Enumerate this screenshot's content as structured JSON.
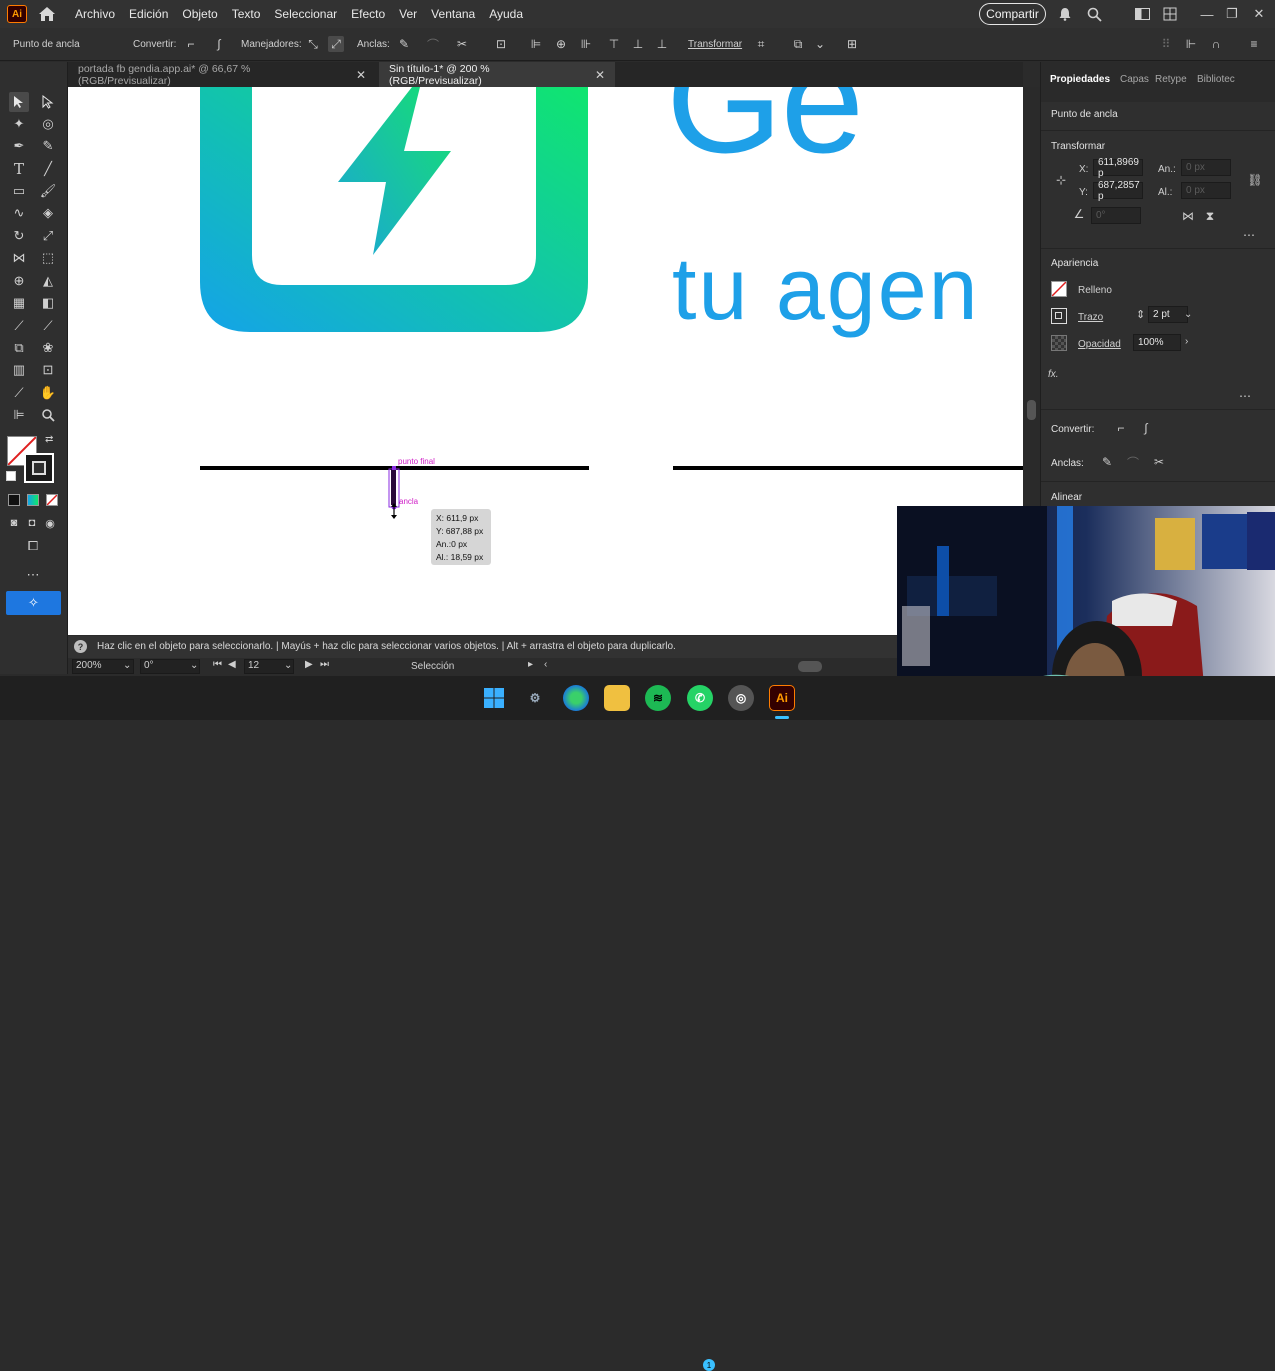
{
  "app": {
    "logo_text": "Ai"
  },
  "menu": {
    "items": [
      "Archivo",
      "Edición",
      "Objeto",
      "Texto",
      "Seleccionar",
      "Efecto",
      "Ver",
      "Ventana",
      "Ayuda"
    ],
    "share_label": "Compartir"
  },
  "control_bar": {
    "tool_name": "Punto de ancla",
    "convertir_label": "Convertir:",
    "manejadores_label": "Manejadores:",
    "anclas_label": "Anclas:",
    "transformar_label": "Transformar"
  },
  "tabs": [
    {
      "label": "portada fb gendia.app.ai* @ 66,67 % (RGB/Previsualizar)",
      "active": false
    },
    {
      "label": "Sin título-1* @ 200 % (RGB/Previsualizar)",
      "active": true
    }
  ],
  "canvas": {
    "logo_word_partial": "Ge",
    "tagline_partial": "tu agen",
    "label_endpoint": "punto final",
    "label_anchor": "ancla",
    "tooltip": {
      "x": "X: 611,9 px",
      "y": "Y: 687,88 px",
      "w": "An.:0 px",
      "h": "Al.: 18,59 px"
    },
    "colors": {
      "logo_blue": "#1ea0e8",
      "gradient_start": "#14a3e8",
      "gradient_end": "#10e86a",
      "selection": "#8a2be2",
      "magenta_label": "#d020c8"
    }
  },
  "status": {
    "hint": "Haz clic en el objeto para seleccionarlo.  |  Mayús + haz clic para seleccionar varios objetos.  |  Alt + arrastra el objeto para duplicarlo.",
    "zoom": "200%",
    "rotation": "0°",
    "artboard_num": "12",
    "mode": "Selección"
  },
  "right_panel": {
    "tabs": [
      "Propiedades",
      "Capas",
      "Retype",
      "Bibliotec"
    ],
    "selection_type": "Punto de ancla",
    "transform_title": "Transformar",
    "x_label": "X:",
    "x_value": "611,8969 p",
    "y_label": "Y:",
    "y_value": "687,2857 p",
    "w_label": "An.:",
    "w_value": "0 px",
    "h_label": "Al.:",
    "h_value": "0 px",
    "angle_value": "0°",
    "appearance_title": "Apariencia",
    "fill_label": "Relleno",
    "stroke_label": "Trazo",
    "stroke_value": "2 pt",
    "opacity_label": "Opacidad",
    "opacity_value": "100%",
    "fx_label": "fx.",
    "convertir_label": "Convertir:",
    "anclas_label": "Anclas:",
    "alinear_label": "Alinear"
  },
  "taskbar": {
    "ai_label": "Ai",
    "whatsapp_badge": "1"
  }
}
